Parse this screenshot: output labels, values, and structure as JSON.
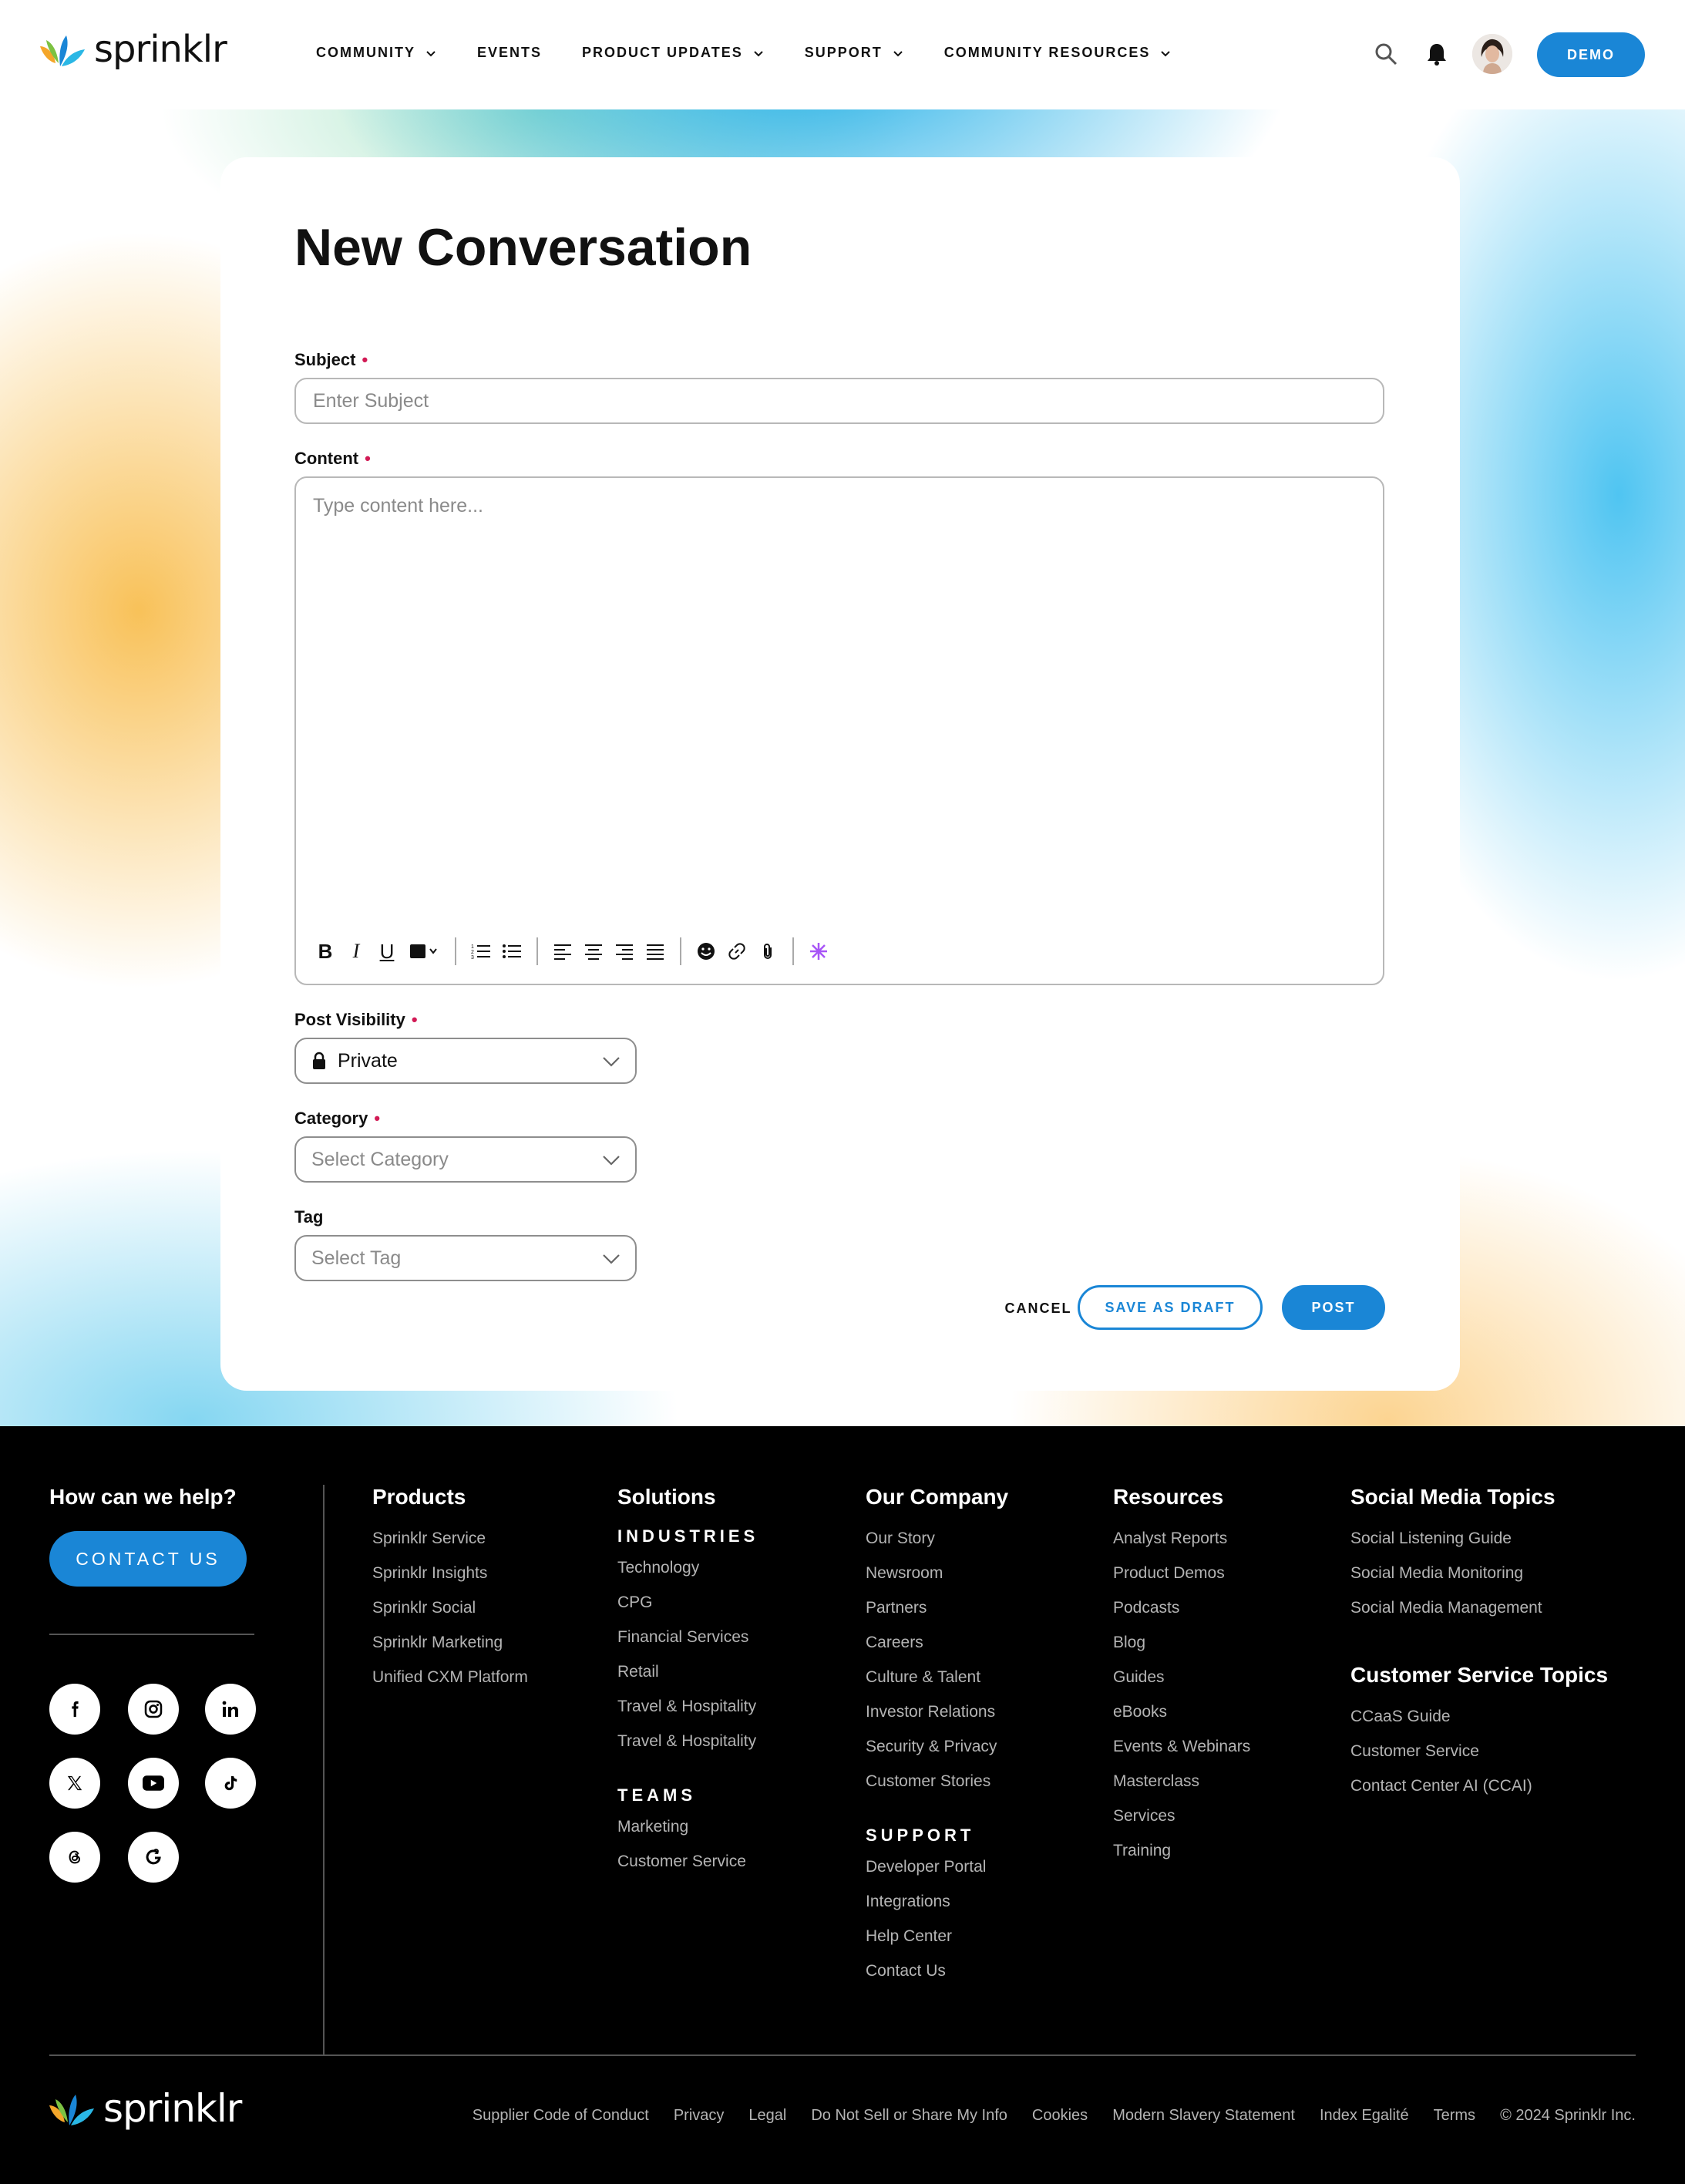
{
  "header": {
    "brand": "sprinklr",
    "nav": [
      {
        "label": "COMMUNITY",
        "has_dropdown": true
      },
      {
        "label": "EVENTS",
        "has_dropdown": false
      },
      {
        "label": "PRODUCT UPDATES",
        "has_dropdown": true
      },
      {
        "label": "SUPPORT",
        "has_dropdown": true
      },
      {
        "label": "COMMUNITY RESOURCES",
        "has_dropdown": true
      }
    ],
    "icons": [
      "search-icon",
      "bell-icon",
      "avatar"
    ],
    "demo_label": "DEMO"
  },
  "form": {
    "title": "New Conversation",
    "subject": {
      "label": "Subject",
      "required_mark": "•",
      "placeholder": "Enter Subject",
      "value": ""
    },
    "content": {
      "label": "Content",
      "required_mark": "•",
      "placeholder": "Type content here...",
      "value": ""
    },
    "toolbar": {
      "bold": "B",
      "italic": "I",
      "underline": "U",
      "icons": [
        "text-color-icon",
        "ordered-list-icon",
        "bullet-list-icon",
        "align-left-icon",
        "align-center-icon",
        "align-right-icon",
        "align-justify-icon",
        "emoji-icon",
        "link-icon",
        "attachment-icon",
        "ai-sparkle-icon"
      ]
    },
    "post_visibility": {
      "label": "Post Visibility",
      "required_mark": "•",
      "value": "Private",
      "icon": "lock-icon"
    },
    "category": {
      "label": "Category",
      "required_mark": "•",
      "placeholder": "Select Category"
    },
    "tag": {
      "label": "Tag",
      "placeholder": "Select Tag"
    },
    "buttons": {
      "cancel": "CANCEL",
      "save_draft": "SAVE AS DRAFT",
      "post": "POST"
    }
  },
  "footer": {
    "help_title": "How can we help?",
    "contact_label": "CONTACT US",
    "social_icons": [
      "facebook-icon",
      "instagram-icon",
      "linkedin-icon",
      "x-icon",
      "youtube-icon",
      "tiktok-icon",
      "threads-icon",
      "g2-icon"
    ],
    "products": {
      "title": "Products",
      "links": [
        "Sprinklr Service",
        "Sprinklr Insights",
        "Sprinklr Social",
        "Sprinklr Marketing",
        "Unified CXM Platform"
      ]
    },
    "solutions": {
      "title": "Solutions",
      "industries_title": "INDUSTRIES",
      "industries": [
        "Technology",
        "CPG",
        "Financial Services",
        "Retail",
        "Travel & Hospitality",
        "Travel & Hospitality"
      ],
      "teams_title": "TEAMS",
      "teams": [
        "Marketing",
        "Customer Service"
      ]
    },
    "company": {
      "title": "Our Company",
      "links": [
        "Our Story",
        "Newsroom",
        "Partners",
        "Careers",
        "Culture & Talent",
        "Investor Relations",
        "Security & Privacy",
        "Customer Stories"
      ],
      "support_title": "SUPPORT",
      "support_links": [
        "Developer Portal",
        "Integrations",
        "Help Center",
        "Contact Us"
      ]
    },
    "resources": {
      "title": "Resources",
      "links": [
        "Analyst Reports",
        "Product Demos",
        "Podcasts",
        "Blog",
        "Guides",
        "eBooks",
        "Events & Webinars",
        "Masterclass",
        "Services",
        "Training"
      ]
    },
    "social_topics": {
      "title": "Social Media Topics",
      "links": [
        "Social Listening Guide",
        "Social Media Monitoring",
        "Social Media Management"
      ]
    },
    "service_topics": {
      "title": "Customer Service Topics",
      "links": [
        "CCaaS Guide",
        "Customer Service",
        "Contact Center AI (CCAI)"
      ]
    },
    "brand": "sprinklr",
    "legal_links": [
      "Supplier Code of Conduct",
      "Privacy",
      "Legal",
      "Do Not Sell or Share My Info",
      "Cookies",
      "Modern Slavery Statement",
      "Index Egalité",
      "Terms"
    ],
    "copyright": "© 2024 Sprinklr Inc."
  },
  "colors": {
    "accent": "#1a86d6",
    "required": "#d21a55",
    "ai_sparkle": "#a855f7"
  }
}
